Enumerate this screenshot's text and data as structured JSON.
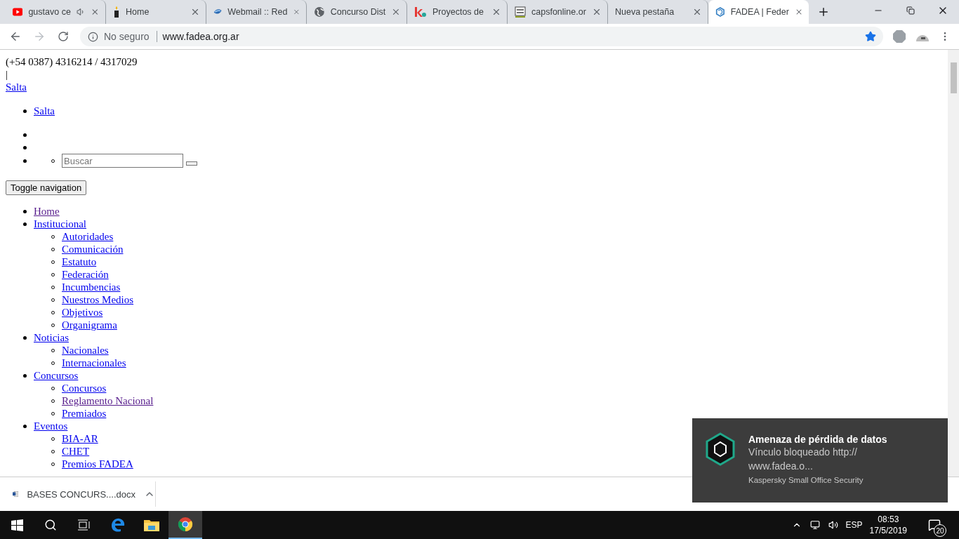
{
  "tabs": [
    {
      "title": "gustavo ce",
      "audio": true,
      "selected": false
    },
    {
      "title": "Home",
      "audio": false,
      "selected": false
    },
    {
      "title": "Webmail :: Red",
      "audio": false,
      "selected": false
    },
    {
      "title": "Concurso Dist",
      "audio": false,
      "selected": false
    },
    {
      "title": "Proyectos de",
      "audio": false,
      "selected": false
    },
    {
      "title": "capsfonline.or",
      "audio": false,
      "selected": false
    },
    {
      "title": "Nueva pestaña",
      "audio": false,
      "selected": false
    },
    {
      "title": "FADEA | Feder",
      "audio": false,
      "selected": true
    }
  ],
  "address": {
    "security": "No seguro",
    "url": "www.fadea.org.ar",
    "bookmarked": true
  },
  "page": {
    "phone": "(+54 0387) 4316214 / 4317029",
    "separator": "|",
    "region_link": "Salta",
    "region_list": [
      {
        "label": "Salta",
        "visited": false
      }
    ],
    "header_list": [
      {
        "kind": "empty"
      },
      {
        "kind": "empty"
      },
      {
        "kind": "search",
        "placeholder": "Buscar"
      }
    ],
    "toggle_button": "Toggle navigation",
    "nav": [
      {
        "label": "Home",
        "visited": true
      },
      {
        "label": "Institucional",
        "visited": false,
        "children": [
          {
            "label": "Autoridades",
            "visited": false
          },
          {
            "label": "Comunicación",
            "visited": false
          },
          {
            "label": "Estatuto",
            "visited": false
          },
          {
            "label": "Federación",
            "visited": false
          },
          {
            "label": "Incumbencias",
            "visited": false
          },
          {
            "label": "Nuestros Medios",
            "visited": false
          },
          {
            "label": "Objetivos",
            "visited": false
          },
          {
            "label": "Organigrama",
            "visited": false
          }
        ]
      },
      {
        "label": "Noticias",
        "visited": false,
        "children": [
          {
            "label": "Nacionales",
            "visited": false
          },
          {
            "label": "Internacionales",
            "visited": false
          }
        ]
      },
      {
        "label": "Concursos",
        "visited": false,
        "children": [
          {
            "label": "Concursos",
            "visited": false
          },
          {
            "label": "Reglamento Nacional",
            "visited": true
          },
          {
            "label": "Premiados",
            "visited": false
          }
        ]
      },
      {
        "label": "Eventos",
        "visited": false,
        "children": [
          {
            "label": "BIA-AR",
            "visited": false
          },
          {
            "label": "CHET",
            "visited": false
          },
          {
            "label": "Premios FADEA",
            "visited": false
          }
        ]
      }
    ]
  },
  "download": {
    "file": "BASES CONCURS....docx"
  },
  "notification": {
    "title": "Amenaza de pérdida de datos",
    "body_lines": [
      "Vínculo bloqueado http://",
      "www.fadea.o..."
    ],
    "source": "Kaspersky Small Office Security"
  },
  "taskbar": {
    "apps": [
      {
        "kind": "edge",
        "selected": false
      },
      {
        "kind": "explorer",
        "selected": false
      },
      {
        "kind": "chrome",
        "selected": true
      }
    ],
    "language": "ESP",
    "time": "08:53",
    "date": "17/5/2019",
    "notifications": "20"
  }
}
